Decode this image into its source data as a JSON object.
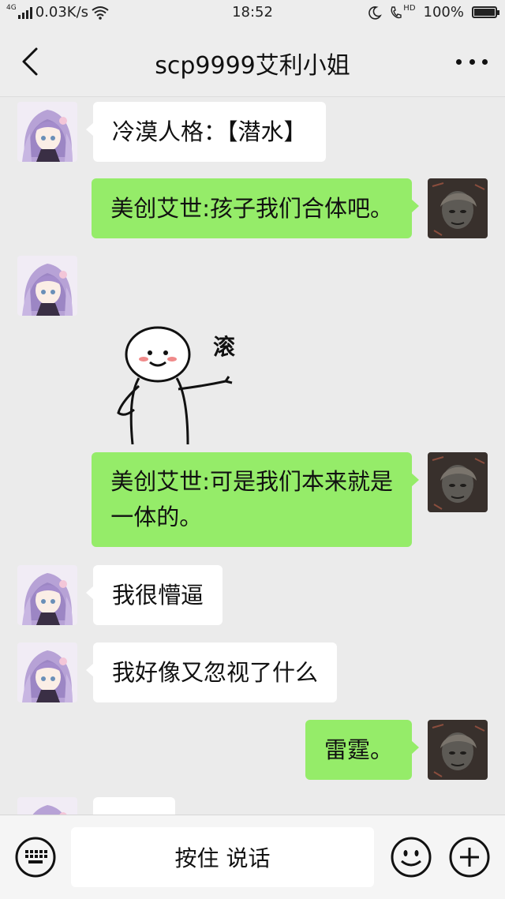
{
  "status_bar": {
    "network": "4G",
    "speed": "0.03K/s",
    "time": "18:52",
    "hd": "HD",
    "battery": "100%",
    "battery_level": 1.0
  },
  "nav": {
    "back_icon": "chevron-left-icon",
    "title": "scp9999艾利小姐",
    "more_icon": "more-dots-icon"
  },
  "messages": [
    {
      "side": "left",
      "type": "text",
      "text": "冷漠人格：【潜水】"
    },
    {
      "side": "right",
      "type": "text",
      "text": "美创艾世:孩子我们合体吧。"
    },
    {
      "side": "left",
      "type": "sticker",
      "text": "滚"
    },
    {
      "side": "right",
      "type": "text",
      "line1": "美创艾世:可是我们本来就是",
      "line2": "一体的。"
    },
    {
      "side": "left",
      "type": "text",
      "text": "我很懵逼"
    },
    {
      "side": "left",
      "type": "text",
      "text": "我好像又忽视了什么"
    },
    {
      "side": "right",
      "type": "text",
      "text": "雷霆。"
    },
    {
      "side": "left",
      "type": "text",
      "text": ""
    }
  ],
  "input_bar": {
    "keyboard_icon": "keyboard-icon",
    "hold_to_talk": "按住 说话",
    "emoji_icon": "emoji-icon",
    "plus_icon": "plus-circle-icon"
  },
  "colors": {
    "background": "#ebebeb",
    "bubble_self": "#95ec69",
    "bubble_other": "#ffffff"
  }
}
